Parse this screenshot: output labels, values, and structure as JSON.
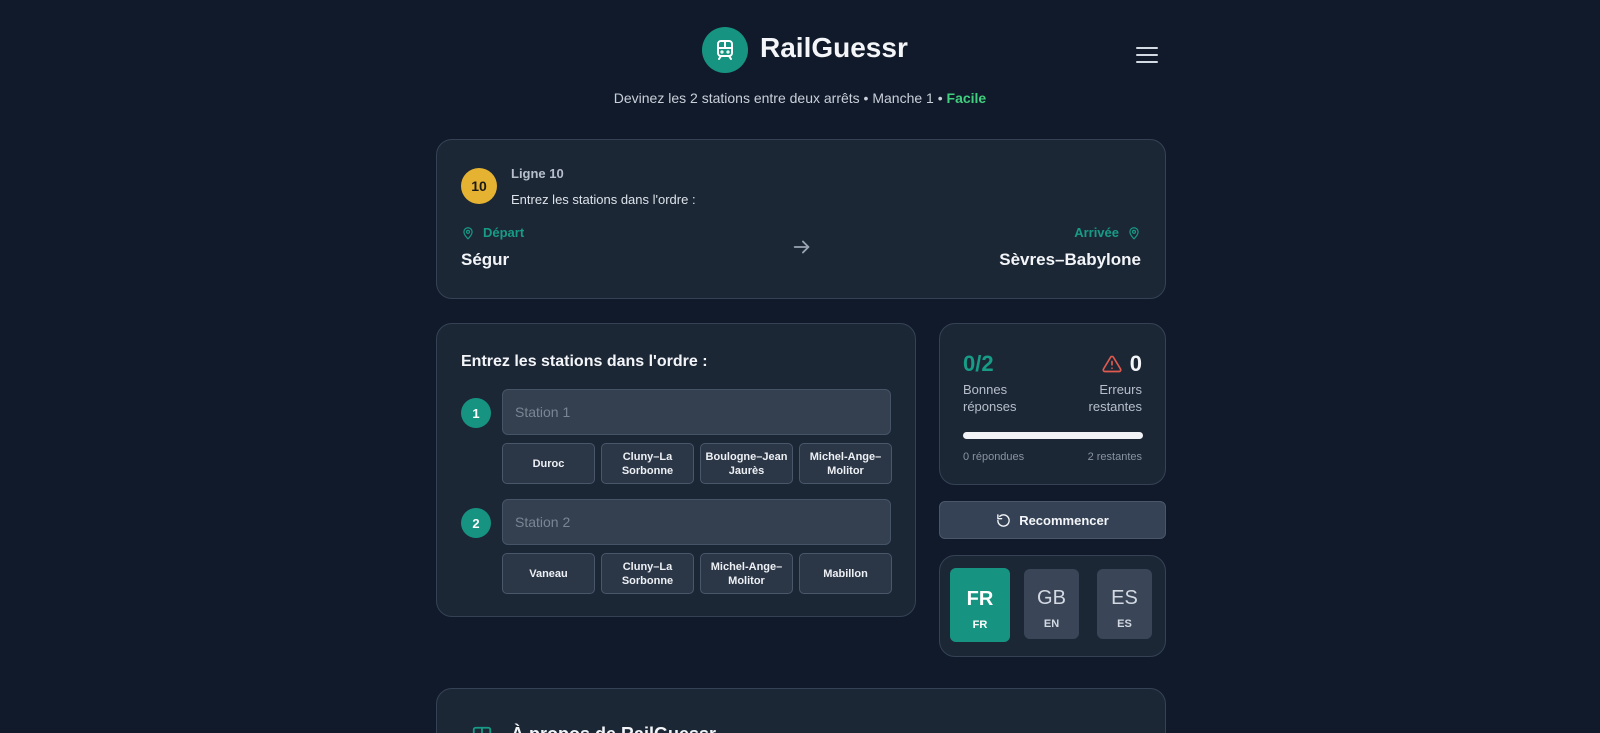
{
  "header": {
    "app_title": "RailGuessr",
    "subtitle_main": "Devinez les 2 stations entre deux arrêts • Manche 1 • ",
    "difficulty": "Facile"
  },
  "route": {
    "line_number": "10",
    "line_label": "Ligne 10",
    "instruction": "Entrez les stations dans l'ordre :",
    "departure_label": "Départ",
    "departure_station": "Ségur",
    "arrival_label": "Arrivée",
    "arrival_station": "Sèvres–Babylone",
    "line_color": "#e5b331"
  },
  "inputs": {
    "title": "Entrez les stations dans l'ordre :",
    "slots": [
      {
        "number": "1",
        "placeholder": "Station 1",
        "value": "",
        "suggestions": [
          "Duroc",
          "Cluny–La Sorbonne",
          "Boulogne–Jean Jaurès",
          "Michel-Ange–Molitor"
        ]
      },
      {
        "number": "2",
        "placeholder": "Station 2",
        "value": "",
        "suggestions": [
          "Vaneau",
          "Cluny–La Sorbonne",
          "Michel-Ange–Molitor",
          "Mabillon"
        ]
      }
    ]
  },
  "score": {
    "correct": "0/2",
    "correct_label": "Bonnes réponses",
    "errors": "0",
    "errors_label": "Erreurs restantes",
    "progress_fraction": 0,
    "answered": "0 répondues",
    "remaining": "2 restantes"
  },
  "restart_label": "Recommencer",
  "languages": [
    {
      "code": "FR",
      "sub": "FR",
      "active": true
    },
    {
      "code": "GB",
      "sub": "EN",
      "active": false
    },
    {
      "code": "ES",
      "sub": "ES",
      "active": false
    }
  ],
  "about": {
    "title": "À propos de RailGuessr"
  },
  "colors": {
    "accent": "#169481",
    "background": "#111a2a",
    "card": "#1c2736",
    "easy": "#3fcf7d",
    "warning": "#e05a4f"
  }
}
